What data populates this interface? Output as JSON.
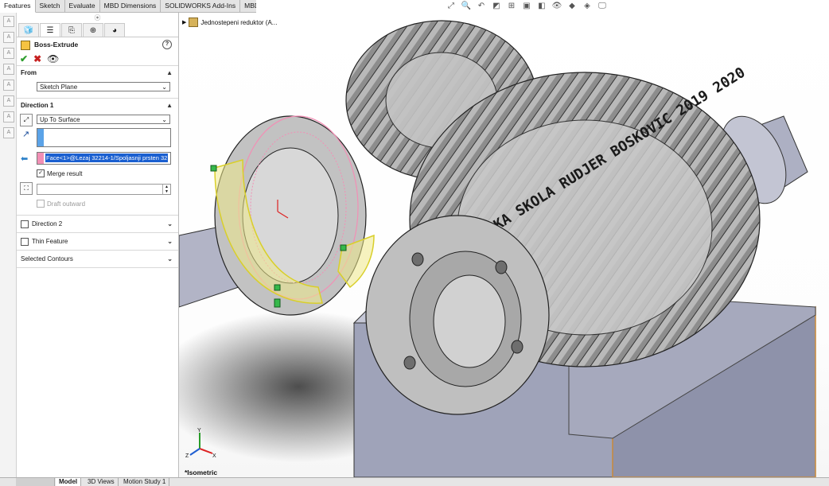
{
  "command_tabs": [
    "Features",
    "Sketch",
    "Evaluate",
    "MBD Dimensions",
    "SOLIDWORKS Add-Ins",
    "MBD"
  ],
  "active_command_tab": "Features",
  "heads_up_toolbar": {
    "icons": [
      "zoom-fit-icon",
      "zoom-area-icon",
      "previous-view-icon",
      "section-view-icon",
      "dynamic-annotation-icon",
      "view-orientation-icon",
      "display-style-icon",
      "hide-show-icon",
      "edit-appearance-icon",
      "apply-scene-icon",
      "view-settings-icon"
    ]
  },
  "property_manager": {
    "tabs": [
      "feature-manager-icon",
      "property-manager-icon",
      "configuration-manager-icon",
      "dimxpert-manager-icon",
      "display-manager-icon"
    ],
    "title": "Boss-Extrude",
    "help": "?",
    "from": {
      "label": "From",
      "value": "Sketch Plane"
    },
    "direction1": {
      "label": "Direction 1",
      "end_condition": "Up To Surface",
      "selected_face": "Face<1>@Lezaj 32214-1/Spoljasnji prsten 32",
      "merge_result_label": "Merge result",
      "merge_result_checked": true,
      "draft_outward_label": "Draft outward",
      "draft_outward_checked": false
    },
    "direction2": {
      "label": "Direction 2",
      "checked": false
    },
    "thin_feature": {
      "label": "Thin Feature",
      "checked": false
    },
    "selected_contours": {
      "label": "Selected Contours"
    }
  },
  "feature_tree": {
    "root": "Jednostepeni reduktor  (A..."
  },
  "viewport": {
    "view_label": "*Isometric",
    "gear_engraving": "TEHNICKA SKOLA RUDJER BOSKOVIC 2019 2020",
    "triad_axes": [
      "Y",
      "X",
      "Z"
    ]
  },
  "bottom_tabs": [
    "Model",
    "3D Views",
    "Motion Study 1"
  ],
  "active_bottom_tab": "Model",
  "colors": {
    "selection_highlight": "#1a5fd0",
    "face_pink": "#f28fb5",
    "preview_yellow": "#f2ea5a",
    "box_fill": "#9fa3b9",
    "box_edge": "#c98a3a"
  }
}
